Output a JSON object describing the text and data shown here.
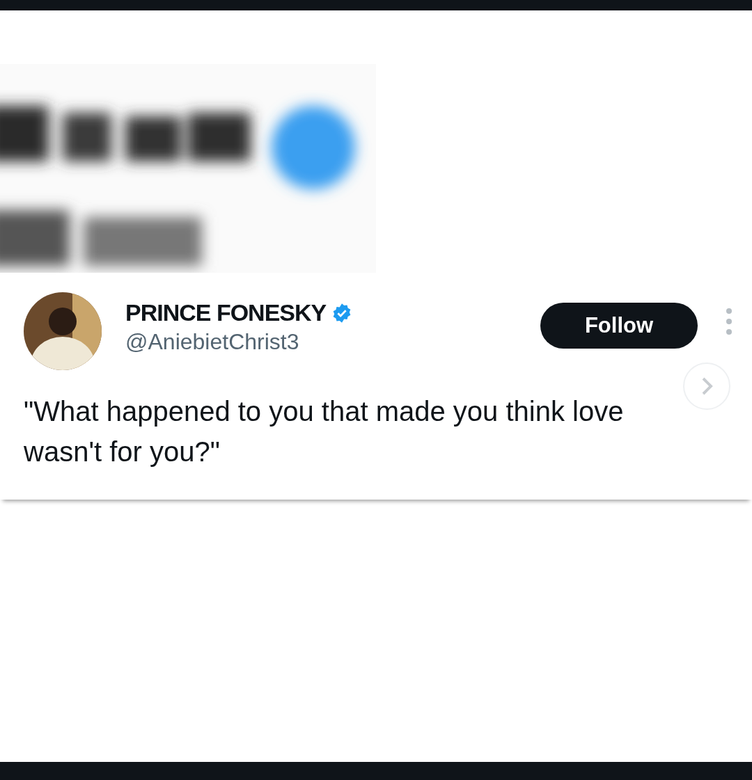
{
  "tweet": {
    "display_name": "PRINCE FONESKY",
    "verified": true,
    "handle": "@AniebietChrist3",
    "follow_button": "Follow",
    "text": "\"What happened to you that made you think love wasn't for you?\""
  }
}
